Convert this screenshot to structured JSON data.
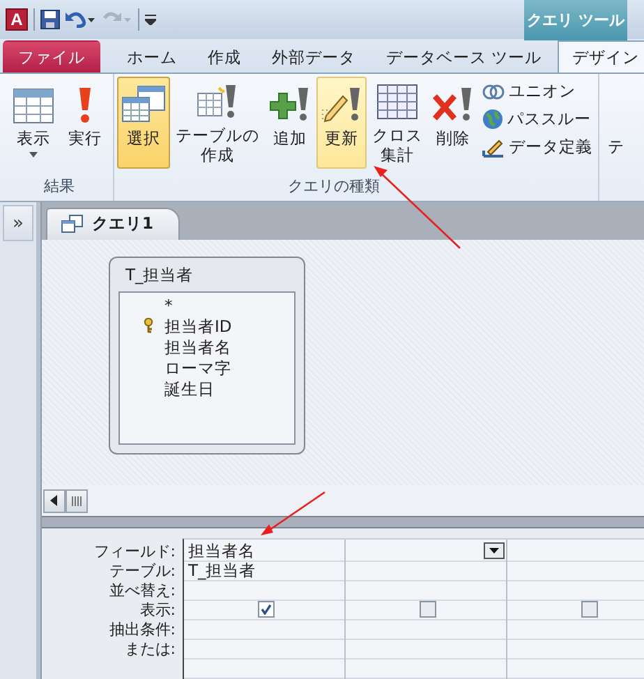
{
  "title_bar": {
    "app_icon": "A",
    "context_header": "クエリ ツール"
  },
  "tabs": [
    {
      "label": "ファイル",
      "kind": "file",
      "selected": false
    },
    {
      "label": "ホーム",
      "kind": "normal",
      "selected": false
    },
    {
      "label": "作成",
      "kind": "normal",
      "selected": false
    },
    {
      "label": "外部データ",
      "kind": "normal",
      "selected": false
    },
    {
      "label": "データベース ツール",
      "kind": "normal",
      "selected": false
    },
    {
      "label": "デザイン",
      "kind": "normal",
      "selected": true
    }
  ],
  "ribbon": {
    "groups": [
      {
        "label": "結果",
        "buttons": [
          {
            "label": "表示",
            "dropdown": true,
            "selected": false,
            "highlighted": false
          },
          {
            "label": "実行",
            "selected": false,
            "highlighted": false
          }
        ]
      },
      {
        "label": "クエリの種類",
        "buttons": [
          {
            "label": "選択",
            "selected": true,
            "highlighted": false
          },
          {
            "lines": [
              "テーブルの",
              "作成"
            ],
            "selected": false,
            "highlighted": false
          },
          {
            "label": "追加",
            "selected": false,
            "highlighted": false
          },
          {
            "label": "更新",
            "selected": false,
            "highlighted": true
          },
          {
            "lines": [
              "クロス",
              "集計"
            ],
            "selected": false,
            "highlighted": false
          },
          {
            "label": "削除",
            "selected": false,
            "highlighted": false
          }
        ],
        "small_buttons": [
          {
            "label": "ユニオン"
          },
          {
            "label": "パススルー"
          },
          {
            "label": "データ定義"
          }
        ]
      }
    ],
    "cut_group_text": "テ"
  },
  "nav_toggle": "»",
  "document_tab": {
    "label": "クエリ1"
  },
  "table_box": {
    "title": "T_担当者",
    "fields": [
      {
        "name": "*",
        "primary_key": false
      },
      {
        "name": "担当者ID",
        "primary_key": true
      },
      {
        "name": "担当者名",
        "primary_key": false
      },
      {
        "name": "ローマ字",
        "primary_key": false
      },
      {
        "name": "誕生日",
        "primary_key": false
      }
    ]
  },
  "grid": {
    "row_labels": [
      "フィールド:",
      "テーブル:",
      "並べ替え:",
      "表示:",
      "抽出条件:",
      "または:"
    ],
    "columns": [
      {
        "field": "担当者名",
        "table": "T_担当者",
        "show": true
      },
      {
        "show": false,
        "dropdown": true
      },
      {
        "show": false
      }
    ]
  }
}
